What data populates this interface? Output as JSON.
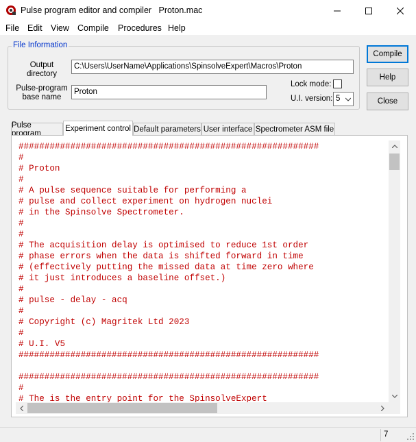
{
  "window": {
    "title": "Pulse program editor and compiler   Proton.mac",
    "app_icon": "magritek-logo-icon",
    "controls": [
      "minimize-icon",
      "maximize-icon",
      "close-icon"
    ]
  },
  "menu": [
    "File",
    "Edit",
    "View",
    "Compile",
    "Procedures",
    "Help"
  ],
  "file_info": {
    "legend": "File Information",
    "output_directory_label_line1": "Output",
    "output_directory_label_line2": "directory",
    "output_directory_value": "C:\\Users\\UserName\\Applications\\SpinsolveExpert\\Macros\\Proton",
    "base_name_label_line1": "Pulse-program",
    "base_name_label_line2": "base name",
    "base_name_value": "Proton",
    "lock_mode_label": "Lock mode:",
    "lock_mode_checked": false,
    "ui_version_label": "U.I. version:",
    "ui_version_value": "5"
  },
  "buttons": {
    "compile": "Compile",
    "help": "Help",
    "close": "Close"
  },
  "tabs": [
    "Pulse program",
    "Experiment control",
    "Default parameters",
    "User interface",
    "Spectrometer ASM file"
  ],
  "active_tab": "Experiment control",
  "code_lines": [
    "##########################################################",
    "#",
    "# Proton",
    "#",
    "# A pulse sequence suitable for performing a",
    "# pulse and collect experiment on hydrogen nuclei",
    "# in the Spinsolve Spectrometer.",
    "#",
    "#",
    "# The acquisition delay is optimised to reduce 1st order",
    "# phase errors when the data is shifted forward in time",
    "# (effectively putting the missed data at time zero where",
    "# it just introduces a baseline offset.)",
    "#",
    "# pulse - delay - acq",
    "#",
    "# Copyright (c) Magritek Ltd 2023",
    "#",
    "# U.I. V5",
    "##########################################################",
    "",
    "##########################################################",
    "#",
    "# The is the entry point for the SpinsolveExpert"
  ],
  "code_color": "#c00000",
  "status": {
    "value": "7"
  }
}
